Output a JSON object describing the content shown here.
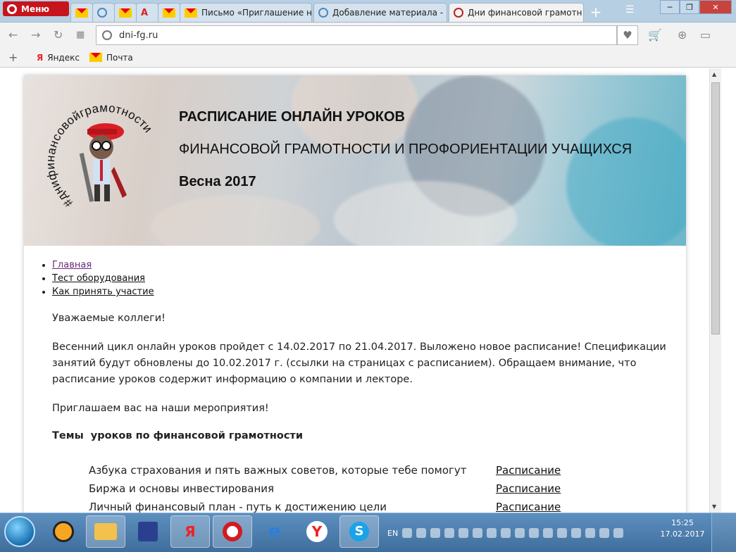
{
  "browser": {
    "menu_label": "Меню",
    "tabs": [
      {
        "label": ""
      },
      {
        "label": ""
      },
      {
        "label": ""
      },
      {
        "label": ""
      },
      {
        "label": "Письмо «Приглашение н"
      },
      {
        "label": "Добавление материала -"
      },
      {
        "label": "Дни финансовой грамотн"
      }
    ],
    "url": "dni-fg.ru",
    "bookmarks": [
      {
        "label": "Яндекс"
      },
      {
        "label": "Почта"
      }
    ]
  },
  "banner": {
    "line1": "РАСПИСАНИЕ ОНЛАЙН УРОКОВ",
    "line2": "ФИНАНСОВОЙ ГРАМОТНОСТИ И ПРОФОРИЕНТАЦИИ УЧАЩИХСЯ",
    "line3": "Весна 2017",
    "logo_text": "#днифинансовойграмотности"
  },
  "nav": {
    "items": [
      {
        "label": "Главная"
      },
      {
        "label": "Тест оборудования"
      },
      {
        "label": "Как принять участие"
      }
    ]
  },
  "content": {
    "greeting": "Уважаемые коллеги!",
    "paragraph1": "Весенний цикл онлайн уроков пройдет с 14.02.2017 по 21.04.2017. Выложено новое расписание! Спецификации занятий будут обновлены до 10.02.2017 г. (ссылки на страницах с расписанием). Обращаем внимание, что расписание уроков содержит информацию о компании и лекторе.",
    "paragraph2": "Приглашаем вас на наши мероприятия!",
    "section_title": "Темы  уроков по финансовой грамотности",
    "lessons": [
      {
        "name": "Азбука страхования и пять важных советов, которые тебе помогут",
        "link": "Расписание"
      },
      {
        "name": "Биржа и основы инвестирования",
        "link": "Расписание"
      },
      {
        "name": "Личный финансовый план - путь к достижению цели",
        "link": "Расписание"
      }
    ]
  },
  "taskbar": {
    "lang": "EN",
    "time": "15:25",
    "date": "17.02.2017"
  }
}
